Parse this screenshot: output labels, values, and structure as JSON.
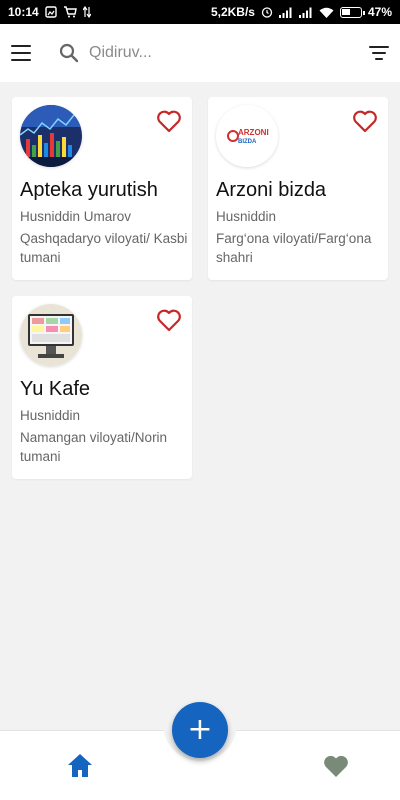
{
  "status_bar": {
    "time": "10:14",
    "network_speed": "5,2KB/s",
    "battery_text": "47%",
    "battery_level": 0.47
  },
  "appbar": {
    "search_placeholder": "Qidiruv..."
  },
  "cards": [
    {
      "title": "Apteka yurutish",
      "owner": "Husniddin Umarov",
      "region": "Qashqadaryo viloyati/ Kasbi tumani",
      "favorite_icon": "heart-outline-icon"
    },
    {
      "title": "Arzoni bizda",
      "owner": "Husniddin",
      "region": "Farg‘ona viloyati/Farg‘ona shahri",
      "logo_text": "ARZONI BIZDA",
      "favorite_icon": "heart-outline-icon"
    },
    {
      "title": "Yu Kafe",
      "owner": "Husniddin",
      "region": "Namangan viloyati/Norin tumani",
      "favorite_icon": "heart-outline-icon"
    }
  ],
  "fab": {
    "label": "+"
  },
  "colors": {
    "accent": "#1565c0",
    "heart": "#c62828",
    "nav_heart": "#7a8a78",
    "background": "#f2f2f2"
  }
}
